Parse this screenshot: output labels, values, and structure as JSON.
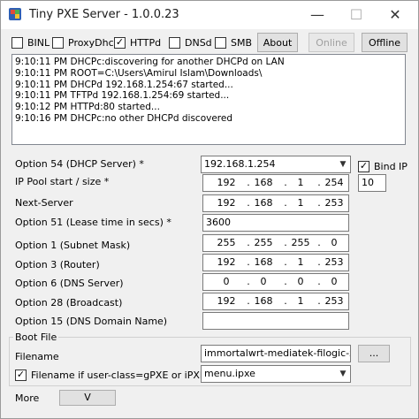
{
  "window": {
    "title": "Tiny PXE Server - 1.0.0.23"
  },
  "titlebar": {
    "min_glyph": "—",
    "max_glyph": "☐",
    "close_glyph": "✕"
  },
  "services": [
    {
      "label": "BINL",
      "checked": false
    },
    {
      "label": "ProxyDhcp",
      "checked": false
    },
    {
      "label": "HTTPd",
      "checked": true
    },
    {
      "label": "DNSd",
      "checked": false
    },
    {
      "label": "SMB",
      "checked": false
    }
  ],
  "buttons": {
    "about": "About",
    "online": "Online",
    "offline": "Offline",
    "ellipsis": "...",
    "more_value": "V"
  },
  "log": [
    "9:10:11 PM DHCPc:discovering for another DHCPd on LAN",
    "9:10:11 PM ROOT=C:\\Users\\Amirul Islam\\Downloads\\",
    "9:10:11 PM DHCPd 192.168.1.254:67 started...",
    "9:10:11 PM TFTPd 192.168.1.254:69 started...",
    "9:10:12 PM HTTPd:80 started...",
    "9:10:16 PM DHCPc:no other DHCPd discovered"
  ],
  "form": {
    "opt54_label": "Option 54 (DHCP Server) *",
    "opt54_value": "192.168.1.254",
    "bind_ip_label": "Bind IP",
    "bind_ip_checked": true,
    "pool_label": "IP Pool start / size *",
    "pool_start": [
      "192",
      "168",
      "1",
      "254"
    ],
    "pool_size": "10",
    "next_label": "Next-Server",
    "next_value": [
      "192",
      "168",
      "1",
      "253"
    ],
    "lease_label": "Option 51 (Lease time in secs) *",
    "lease_value": "3600",
    "mask_label": "Option 1  (Subnet Mask)",
    "mask_value": [
      "255",
      "255",
      "255",
      "0"
    ],
    "router_label": "Option 3  (Router)",
    "router_value": [
      "192",
      "168",
      "1",
      "253"
    ],
    "dns_label": "Option 6  (DNS Server)",
    "dns_value": [
      "0",
      "0",
      "0",
      "0"
    ],
    "bcast_label": "Option 28 (Broadcast)",
    "bcast_value": [
      "192",
      "168",
      "1",
      "253"
    ],
    "domain_label": "Option 15 (DNS Domain Name)",
    "domain_value": ""
  },
  "boot": {
    "group_title": "Boot File",
    "filename_label": "Filename",
    "filename_value": "immortalwrt-mediatek-filogic-xiaomi_re",
    "alt_label": "Filename if user-class=gPXE or iPXE",
    "alt_checked": true,
    "alt_value": "menu.ipxe"
  },
  "more": {
    "label": "More"
  }
}
